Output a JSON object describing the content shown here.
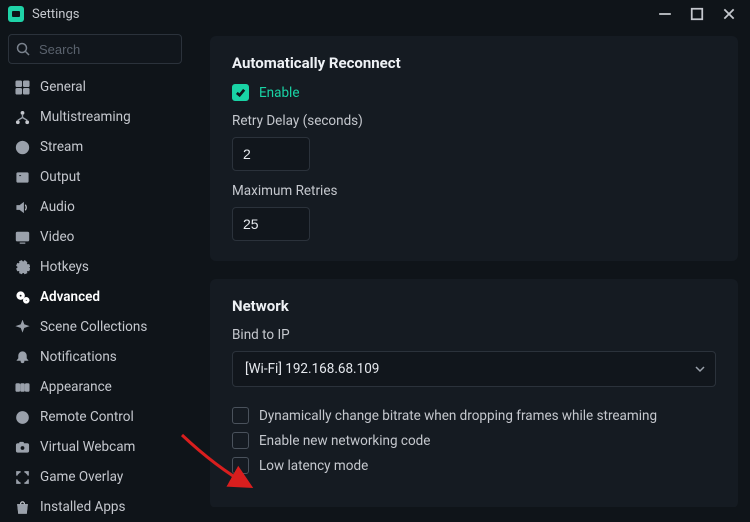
{
  "window": {
    "title": "Settings"
  },
  "colors": {
    "accent": "#19d3a5"
  },
  "sidebar": {
    "search_placeholder": "Search",
    "items": [
      {
        "id": "general",
        "label": "General",
        "icon": "grid-icon",
        "active": false
      },
      {
        "id": "multistreaming",
        "label": "Multistreaming",
        "icon": "fork-icon",
        "active": false
      },
      {
        "id": "stream",
        "label": "Stream",
        "icon": "globe-icon",
        "active": false
      },
      {
        "id": "output",
        "label": "Output",
        "icon": "output-icon",
        "active": false
      },
      {
        "id": "audio",
        "label": "Audio",
        "icon": "speaker-icon",
        "active": false
      },
      {
        "id": "video",
        "label": "Video",
        "icon": "monitor-icon",
        "active": false
      },
      {
        "id": "hotkeys",
        "label": "Hotkeys",
        "icon": "gear-icon",
        "active": false
      },
      {
        "id": "advanced",
        "label": "Advanced",
        "icon": "cogs-icon",
        "active": true
      },
      {
        "id": "scene-collections",
        "label": "Scene Collections",
        "icon": "sparkle-icon",
        "active": false
      },
      {
        "id": "notifications",
        "label": "Notifications",
        "icon": "bell-icon",
        "active": false
      },
      {
        "id": "appearance",
        "label": "Appearance",
        "icon": "swatches-icon",
        "active": false
      },
      {
        "id": "remote-control",
        "label": "Remote Control",
        "icon": "power-icon",
        "active": false
      },
      {
        "id": "virtual-webcam",
        "label": "Virtual Webcam",
        "icon": "camera-icon",
        "active": false
      },
      {
        "id": "game-overlay",
        "label": "Game Overlay",
        "icon": "expand-icon",
        "active": false
      },
      {
        "id": "installed-apps",
        "label": "Installed Apps",
        "icon": "bag-icon",
        "active": false
      }
    ]
  },
  "sections": {
    "reconnect": {
      "title": "Automatically Reconnect",
      "enable_label": "Enable",
      "enable_checked": true,
      "retry_delay_label": "Retry Delay (seconds)",
      "retry_delay_value": "2",
      "max_retries_label": "Maximum Retries",
      "max_retries_value": "25"
    },
    "network": {
      "title": "Network",
      "bind_label": "Bind to IP",
      "bind_value": "[Wi-Fi] 192.168.68.109",
      "opt_dynamic_bitrate": {
        "label": "Dynamically change bitrate when dropping frames while streaming",
        "checked": false
      },
      "opt_new_networking": {
        "label": "Enable new networking code",
        "checked": false
      },
      "opt_low_latency": {
        "label": "Low latency mode",
        "checked": false
      }
    }
  }
}
